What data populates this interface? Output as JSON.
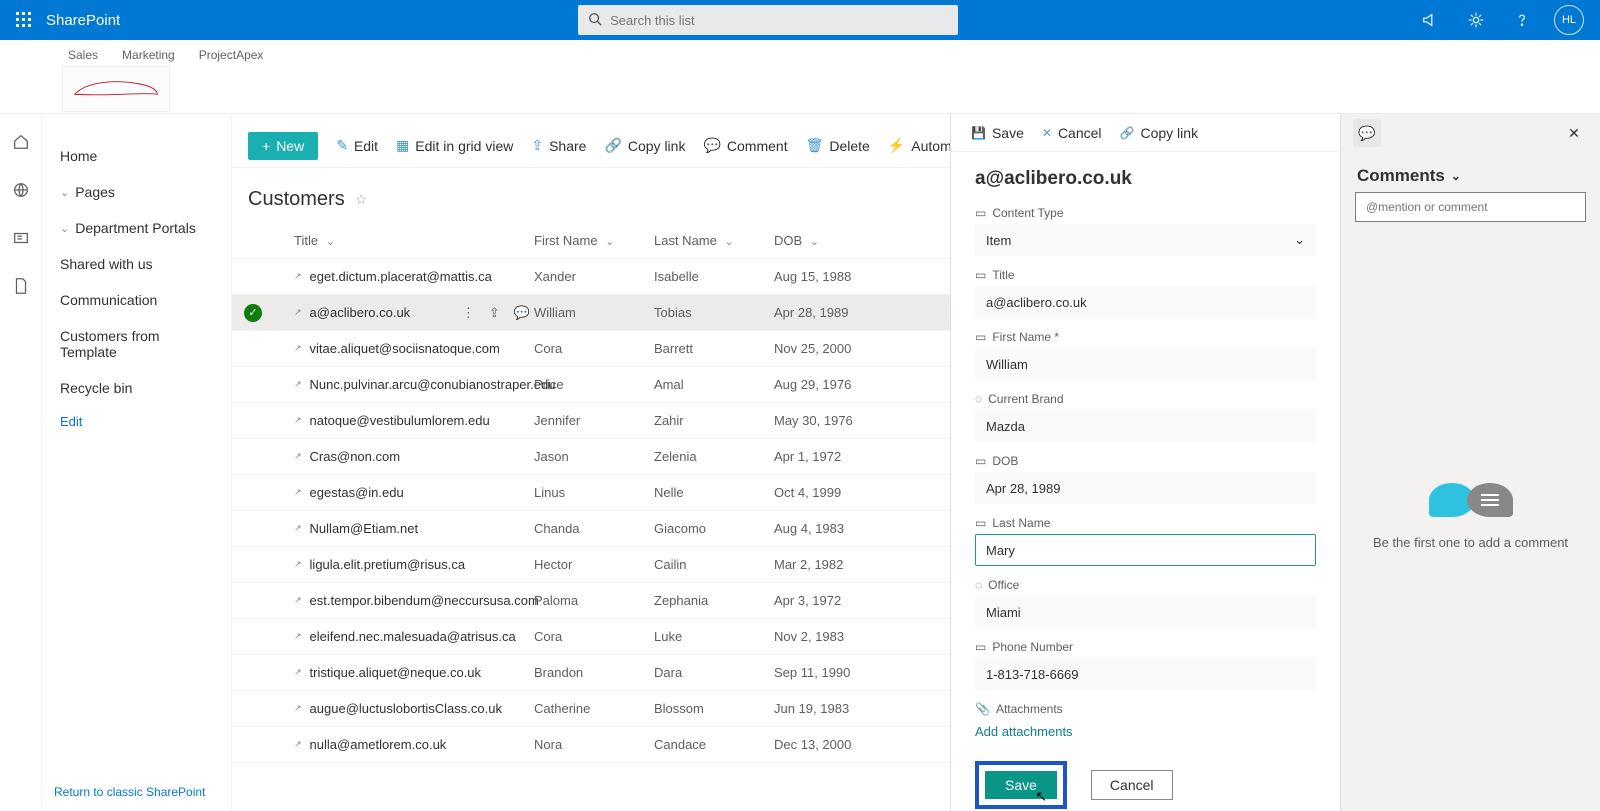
{
  "suite": {
    "title": "SharePoint",
    "search_placeholder": "Search this list",
    "avatar_initials": "HL"
  },
  "site_header": {
    "links": [
      "Sales",
      "Marketing",
      "ProjectApex"
    ],
    "logo_text": ""
  },
  "left_nav": {
    "items": [
      {
        "label": "Home",
        "expandable": false
      },
      {
        "label": "Pages",
        "expandable": true
      },
      {
        "label": "Department Portals",
        "expandable": true
      },
      {
        "label": "Shared with us",
        "expandable": false
      },
      {
        "label": "Communication",
        "expandable": false
      },
      {
        "label": "Customers from Template",
        "expandable": false
      },
      {
        "label": "Recycle bin",
        "expandable": false
      }
    ],
    "edit_label": "Edit",
    "return_label": "Return to classic SharePoint"
  },
  "cmdbar": {
    "new": "New",
    "edit": "Edit",
    "edit_grid": "Edit in grid view",
    "share": "Share",
    "copy_link": "Copy link",
    "comment": "Comment",
    "delete": "Delete",
    "automate": "Automate"
  },
  "list": {
    "title": "Customers",
    "columns": [
      "Title",
      "First Name",
      "Last Name",
      "DOB"
    ],
    "rows": [
      {
        "title": "eget.dictum.placerat@mattis.ca",
        "first": "Xander",
        "last": "Isabelle",
        "dob": "Aug 15, 1988",
        "selected": false
      },
      {
        "title": "a@aclibero.co.uk",
        "first": "William",
        "last": "Tobias",
        "dob": "Apr 28, 1989",
        "selected": true
      },
      {
        "title": "vitae.aliquet@sociisnatoque.com",
        "first": "Cora",
        "last": "Barrett",
        "dob": "Nov 25, 2000",
        "selected": false
      },
      {
        "title": "Nunc.pulvinar.arcu@conubianostraper.edu",
        "first": "Price",
        "last": "Amal",
        "dob": "Aug 29, 1976",
        "selected": false
      },
      {
        "title": "natoque@vestibulumlorem.edu",
        "first": "Jennifer",
        "last": "Zahir",
        "dob": "May 30, 1976",
        "selected": false
      },
      {
        "title": "Cras@non.com",
        "first": "Jason",
        "last": "Zelenia",
        "dob": "Apr 1, 1972",
        "selected": false
      },
      {
        "title": "egestas@in.edu",
        "first": "Linus",
        "last": "Nelle",
        "dob": "Oct 4, 1999",
        "selected": false
      },
      {
        "title": "Nullam@Etiam.net",
        "first": "Chanda",
        "last": "Giacomo",
        "dob": "Aug 4, 1983",
        "selected": false
      },
      {
        "title": "ligula.elit.pretium@risus.ca",
        "first": "Hector",
        "last": "Cailin",
        "dob": "Mar 2, 1982",
        "selected": false
      },
      {
        "title": "est.tempor.bibendum@neccursusa.com",
        "first": "Paloma",
        "last": "Zephania",
        "dob": "Apr 3, 1972",
        "selected": false
      },
      {
        "title": "eleifend.nec.malesuada@atrisus.ca",
        "first": "Cora",
        "last": "Luke",
        "dob": "Nov 2, 1983",
        "selected": false
      },
      {
        "title": "tristique.aliquet@neque.co.uk",
        "first": "Brandon",
        "last": "Dara",
        "dob": "Sep 11, 1990",
        "selected": false
      },
      {
        "title": "augue@luctuslobortisClass.co.uk",
        "first": "Catherine",
        "last": "Blossom",
        "dob": "Jun 19, 1983",
        "selected": false
      },
      {
        "title": "nulla@ametlorem.co.uk",
        "first": "Nora",
        "last": "Candace",
        "dob": "Dec 13, 2000",
        "selected": false
      }
    ]
  },
  "panel": {
    "toolbar": {
      "save": "Save",
      "cancel": "Cancel",
      "copy_link": "Copy link"
    },
    "heading": "a@aclibero.co.uk",
    "labels": {
      "content_type": "Content Type",
      "title": "Title",
      "first_name": "First Name *",
      "current_brand": "Current Brand",
      "dob": "DOB",
      "last_name": "Last Name",
      "office": "Office",
      "phone": "Phone Number",
      "attachments": "Attachments",
      "add_attachments": "Add attachments"
    },
    "values": {
      "content_type": "Item",
      "title": "a@aclibero.co.uk",
      "first_name": "William",
      "current_brand": "Mazda",
      "dob": "Apr 28, 1989",
      "last_name": "Mary",
      "office": "Miami",
      "phone": "1-813-718-6669"
    },
    "buttons": {
      "save": "Save",
      "cancel": "Cancel"
    }
  },
  "comments": {
    "header": "Comments",
    "placeholder": "@mention or comment",
    "empty_text": "Be the first one to add a comment"
  }
}
